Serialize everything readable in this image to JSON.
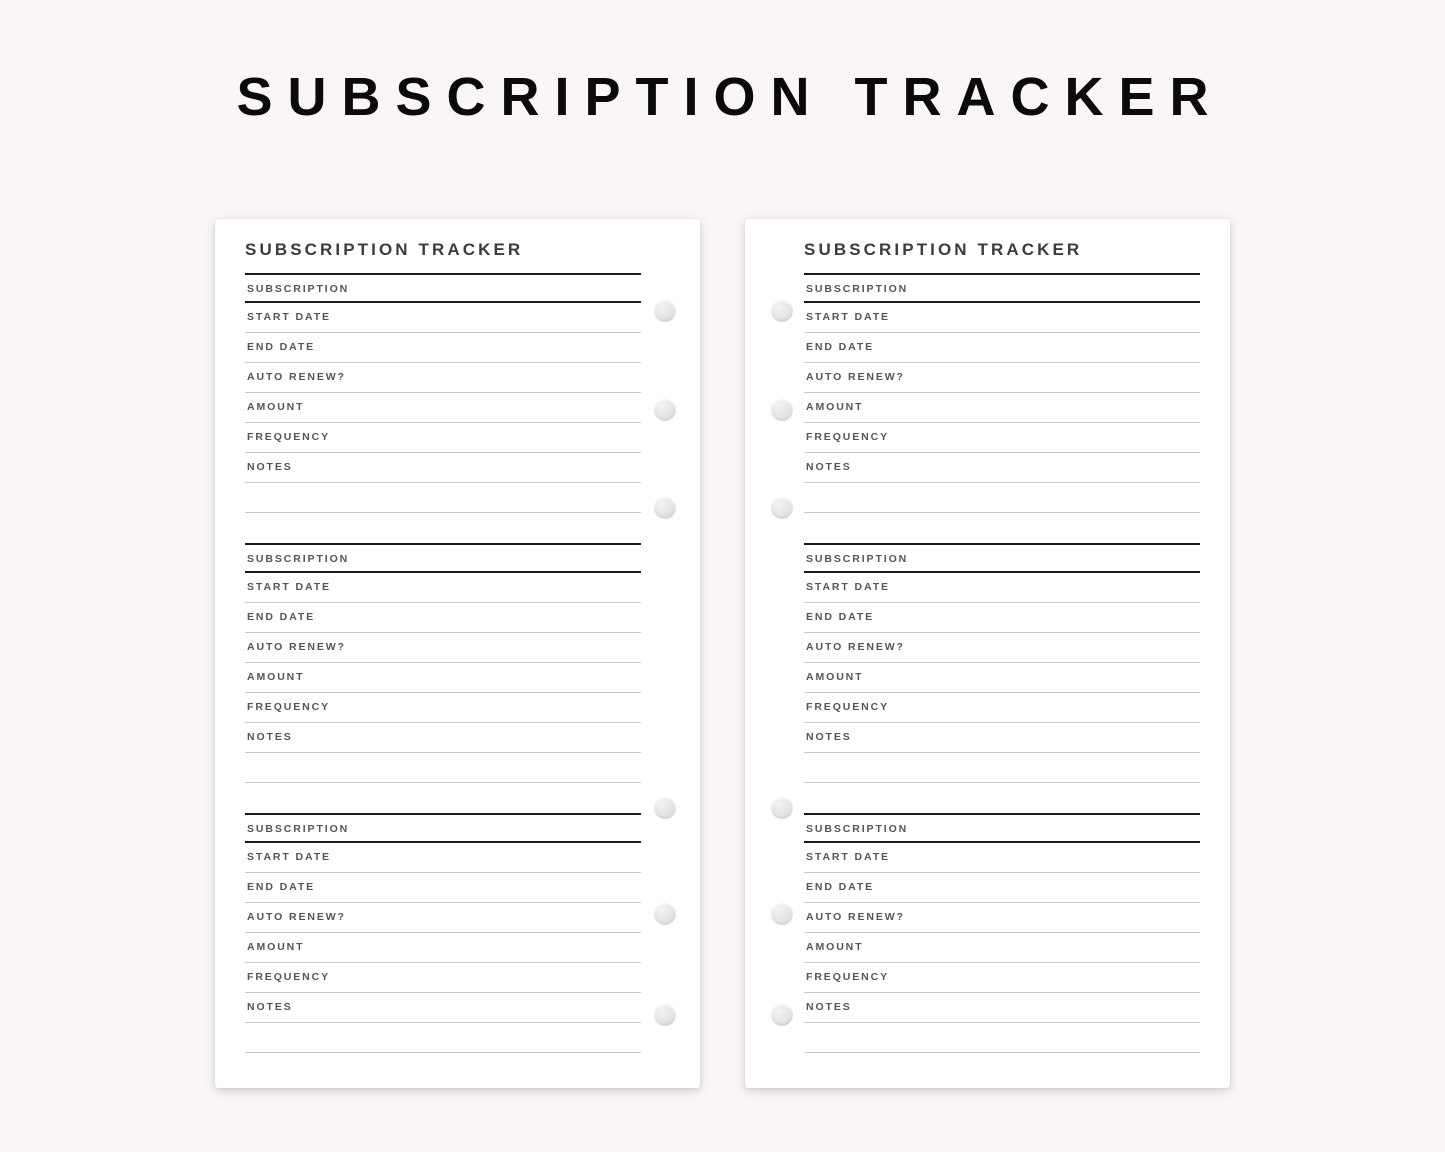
{
  "poster": {
    "title": "SUBSCRIPTION TRACKER",
    "background_color": "#faf6f6",
    "title_color": "#0a0a0a"
  },
  "sheet": {
    "title": "SUBSCRIPTION TRACKER",
    "title_color": "#3c3c3c",
    "label_color": "#555555",
    "thick_rule_color": "#1a1a1a",
    "thin_rule_color": "#c9c9c9",
    "paper_color": "#ffffff",
    "ring_color": "#e0e0e0"
  },
  "entry_fields": {
    "subscription": "SUBSCRIPTION",
    "start_date": "START DATE",
    "end_date": "END DATE",
    "auto_renew": "AUTO RENEW?",
    "amount": "AMOUNT",
    "frequency": "FREQUENCY",
    "notes": "NOTES",
    "blank": ""
  },
  "pages": [
    {
      "side": "left",
      "ring_side": "right",
      "ring_count": 6
    },
    {
      "side": "right",
      "ring_side": "left",
      "ring_count": 6
    }
  ]
}
